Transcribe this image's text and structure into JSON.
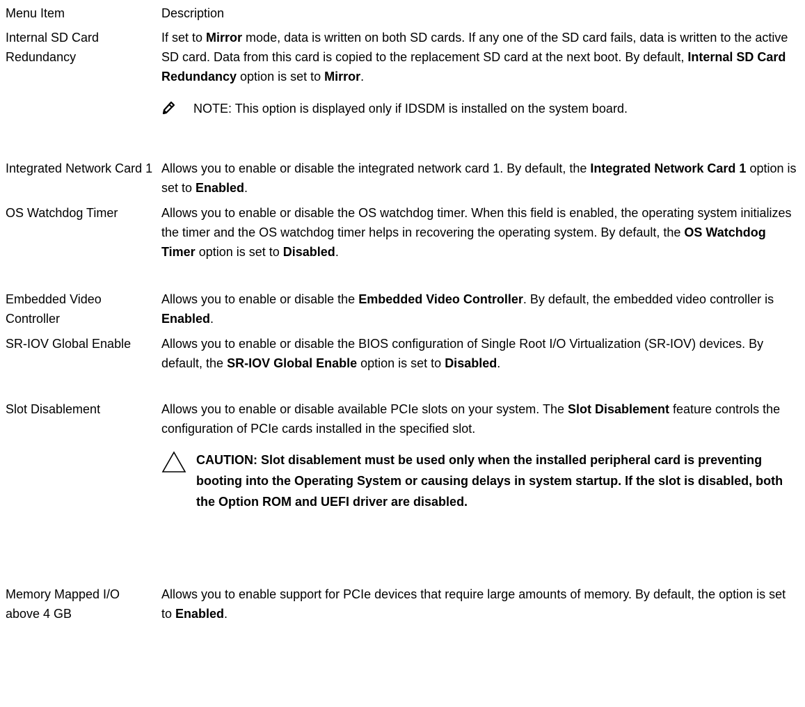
{
  "header": {
    "menu_item": "Menu Item",
    "description": "Description"
  },
  "rows": [
    {
      "item": "Internal SD Card Redundancy",
      "desc": [
        {
          "t": "If set to "
        },
        {
          "t": "Mirror",
          "b": true
        },
        {
          "t": " mode, data is written on both SD cards. If any one of the SD card fails, data is written to the active SD card. Data from this card is copied to the replacement SD card at the next boot. By default, "
        },
        {
          "t": "Internal SD Card Redundancy",
          "b": true
        },
        {
          "t": " option is set to "
        },
        {
          "t": "Mirror",
          "b": true
        },
        {
          "t": "."
        }
      ],
      "note": {
        "label": "NOTE:",
        "text": " This option is displayed only if IDSDM is installed on the system board."
      }
    },
    {
      "item": "Integrated Network Card 1",
      "desc": [
        {
          "t": "Allows you to enable or disable the integrated network card 1. By default, the "
        },
        {
          "t": "Integrated Network Card 1",
          "b": true
        },
        {
          "t": " option is set to "
        },
        {
          "t": "Enabled",
          "b": true
        },
        {
          "t": "."
        }
      ]
    },
    {
      "item": "OS Watchdog Timer",
      "desc": [
        {
          "t": "Allows you to enable or disable the OS watchdog timer. When this field is enabled, the operating system initializes the timer and the OS watchdog timer helps in recovering the operating system. By default, the "
        },
        {
          "t": "OS Watchdog Timer",
          "b": true
        },
        {
          "t": " option is set to "
        },
        {
          "t": "Disabled",
          "b": true
        },
        {
          "t": "."
        }
      ]
    },
    {
      "item": "Embedded Video Controller",
      "desc": [
        {
          "t": "Allows you to enable or disable the "
        },
        {
          "t": "Embedded Video Controller",
          "b": true
        },
        {
          "t": ". By default, the embedded video controller is "
        },
        {
          "t": "Enabled",
          "b": true
        },
        {
          "t": "."
        }
      ]
    },
    {
      "item": "SR-IOV Global Enable",
      "desc": [
        {
          "t": "Allows you to enable or disable the BIOS configuration of Single Root I/O Virtualization (SR-IOV) devices. By default, the "
        },
        {
          "t": "SR-IOV Global Enable",
          "b": true
        },
        {
          "t": " option is set to "
        },
        {
          "t": "Disabled",
          "b": true
        },
        {
          "t": "."
        }
      ]
    },
    {
      "item": "Slot Disablement",
      "desc": [
        {
          "t": "Allows you to enable or disable available PCIe slots on your system. The "
        },
        {
          "t": "Slot Disablement",
          "b": true
        },
        {
          "t": " feature controls the configuration of PCIe cards installed in the specified slot."
        }
      ],
      "caution": "CAUTION: Slot disablement must be used only when the installed peripheral card is preventing booting into the Operating System or causing delays in system startup. If the slot is disabled, both the Option ROM and UEFI driver are disabled."
    },
    {
      "item": "Memory Mapped I/O above 4 GB",
      "desc": [
        {
          "t": "Allows you to enable support for PCIe devices that require large amounts of memory. By default, the option is set to "
        },
        {
          "t": "Enabled",
          "b": true
        },
        {
          "t": "."
        }
      ]
    }
  ],
  "icons": {
    "note": "pencil-note-icon",
    "caution": "warning-triangle-icon"
  }
}
